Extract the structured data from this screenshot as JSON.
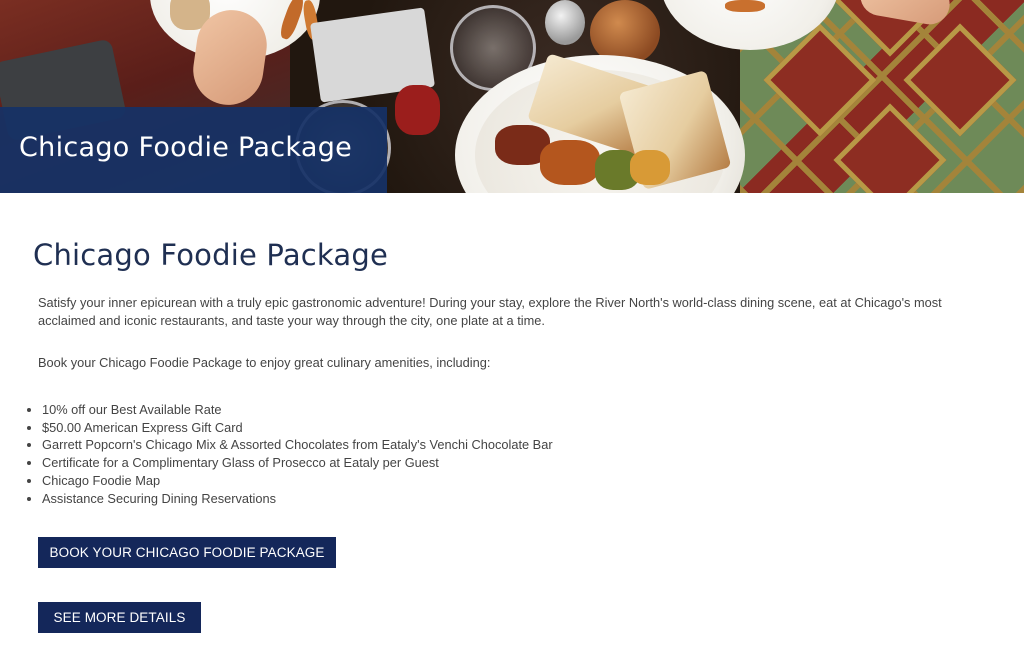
{
  "hero": {
    "banner_title": "Chicago Foodie Package"
  },
  "main": {
    "title": "Chicago Foodie Package",
    "intro": "Satisfy your inner epicurean with a truly epic gastronomic adventure! During your stay, explore the River North's world-class dining scene, eat at Chicago's most acclaimed and iconic restaurants, and taste your way through the city, one plate at a time.",
    "lead": "Book your Chicago Foodie Package to enjoy great culinary amenities, including:",
    "amenities": [
      "10% off our Best Available Rate",
      "$50.00 American Express Gift Card",
      "Garrett Popcorn's Chicago Mix & Assorted Chocolates from Eataly's Venchi Chocolate Bar",
      "Certificate for a Complimentary Glass of Prosecco at Eataly per Guest",
      "Chicago Foodie Map",
      "Assistance Securing Dining Reservations"
    ],
    "buttons": {
      "book": "BOOK YOUR CHICAGO FOODIE PACKAGE",
      "details": "SEE MORE DETAILS"
    }
  },
  "colors": {
    "banner": "#163266",
    "button": "#14275a",
    "title": "#1f2f52",
    "body_text": "#444444"
  }
}
